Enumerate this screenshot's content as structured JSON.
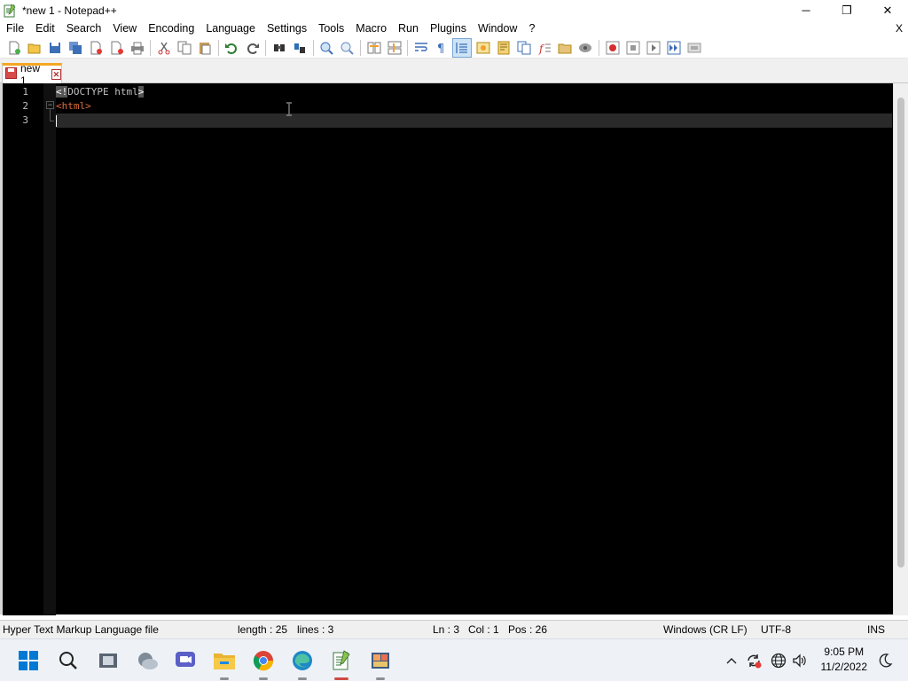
{
  "window": {
    "title": "*new 1 - Notepad++",
    "controls": {
      "minimize": "─",
      "maximize": "❐",
      "close": "✕"
    }
  },
  "menu": {
    "items": [
      "File",
      "Edit",
      "Search",
      "View",
      "Encoding",
      "Language",
      "Settings",
      "Tools",
      "Macro",
      "Run",
      "Plugins",
      "Window",
      "?"
    ],
    "close": "X"
  },
  "toolbar": {
    "icons": [
      "new-file-icon",
      "open-file-icon",
      "save-icon",
      "save-all-icon",
      "close-icon",
      "close-all-icon",
      "print-icon",
      "cut-icon",
      "copy-icon",
      "paste-icon",
      "undo-icon",
      "redo-icon",
      "find-icon",
      "replace-icon",
      "zoom-in-icon",
      "zoom-out-icon",
      "sync-vertical-icon",
      "sync-horizontal-icon",
      "word-wrap-icon",
      "show-all-characters-icon",
      "indent-guide-icon",
      "udl-icon",
      "doc-map-icon",
      "doc-list-icon",
      "function-list-icon",
      "folder-workspace-icon",
      "monitoring-icon",
      "record-macro-icon",
      "stop-record-icon",
      "play-macro-icon",
      "run-macro-multiple-icon",
      "save-macro-icon"
    ]
  },
  "tabs": [
    {
      "label": "new 1",
      "active": true,
      "close": "✕"
    }
  ],
  "editor": {
    "line_numbers": [
      "1",
      "2",
      "3"
    ],
    "lines": [
      {
        "lt": "<",
        "excl": "!",
        "text": "DOCTYPE html",
        "gt": ">"
      },
      {
        "tag": "<html>"
      },
      {
        "text": ""
      }
    ],
    "current_line": 3,
    "fold_marker": "−"
  },
  "status": {
    "file_type": "Hyper Text Markup Language file",
    "length": "length : 25",
    "lines": "lines : 3",
    "ln": "Ln : 3",
    "col": "Col : 1",
    "pos": "Pos : 26",
    "eol": "Windows (CR LF)",
    "encoding": "UTF-8",
    "mode": "INS"
  },
  "taskbar": {
    "apps": [
      "start-icon",
      "search-icon",
      "task-view-icon",
      "weather-icon",
      "teams-chat-icon",
      "file-explorer-icon",
      "chrome-icon",
      "edge-icon",
      "notepad-plus-plus-icon",
      "app-icon"
    ],
    "tray": {
      "chevron": "^",
      "time": "9:05 PM",
      "date": "11/2/2022"
    }
  },
  "colors": {
    "editor_bg": "#000000",
    "tag": "#e06c3a",
    "accent_tab": "#f5a623"
  }
}
